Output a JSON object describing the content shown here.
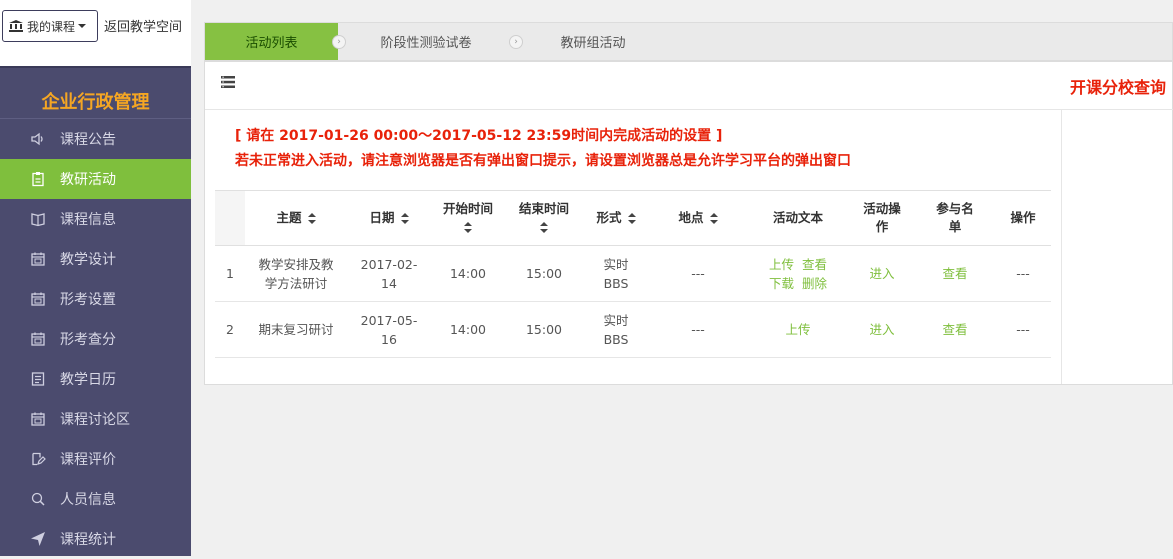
{
  "sidebar": {
    "course_button": "我的课程",
    "back_link": "返回教学空间",
    "title": "企业行政管理",
    "items": [
      {
        "label": "课程公告",
        "icon": "speaker-icon"
      },
      {
        "label": "教研活动",
        "icon": "clipboard-icon",
        "active": true
      },
      {
        "label": "课程信息",
        "icon": "book-icon"
      },
      {
        "label": "教学设计",
        "icon": "calendar-icon"
      },
      {
        "label": "形考设置",
        "icon": "calendar-icon"
      },
      {
        "label": "形考查分",
        "icon": "calendar-icon"
      },
      {
        "label": "教学日历",
        "icon": "list-doc-icon"
      },
      {
        "label": "课程讨论区",
        "icon": "calendar-icon"
      },
      {
        "label": "课程评价",
        "icon": "edit-icon"
      },
      {
        "label": "人员信息",
        "icon": "search-icon"
      },
      {
        "label": "课程统计",
        "icon": "send-icon"
      }
    ]
  },
  "tabs": [
    {
      "label": "活动列表",
      "active": true
    },
    {
      "label": "阶段性测验试卷"
    },
    {
      "label": "教研组活动"
    }
  ],
  "panel": {
    "branch_link": "开课分校查询",
    "notice_line1": "[ 请在 2017-01-26 00:00～2017-05-12 23:59时间内完成活动的设置 ]",
    "notice_line2": "若未正常进入活动，请注意浏览器是否有弹出窗口提示，请设置浏览器总是允许学习平台的弹出窗口"
  },
  "table": {
    "headers": {
      "topic": "主题",
      "date": "日期",
      "start_a": "开始时间",
      "end_a": "结束时间",
      "form": "形式",
      "place": "地点",
      "doc": "活动文本",
      "op_a": "活动操",
      "op_b": "作",
      "part_a": "参与名",
      "part_b": "单",
      "action": "操作"
    },
    "rows": [
      {
        "num": "1",
        "topic_a": "教学安排及教",
        "topic_b": "学方法研讨",
        "date_a": "2017-02-",
        "date_b": "14",
        "start": "14:00",
        "end": "15:00",
        "form_a": "实时",
        "form_b": "BBS",
        "place": "---",
        "doc_links": [
          "上传",
          "查看",
          "下载",
          "删除"
        ],
        "enter": "进入",
        "view": "查看",
        "action": "---"
      },
      {
        "num": "2",
        "topic": "期末复习研讨",
        "date_a": "2017-05-",
        "date_b": "16",
        "start": "14:00",
        "end": "15:00",
        "form_a": "实时",
        "form_b": "BBS",
        "place": "---",
        "doc_links": [
          "上传"
        ],
        "enter": "进入",
        "view": "查看",
        "action": "---"
      }
    ]
  },
  "colors": {
    "sidebar_bg": "#4b4b6e",
    "accent_green": "#7fbf3d",
    "title_orange": "#f5a623",
    "alert_red": "#e8220a"
  }
}
